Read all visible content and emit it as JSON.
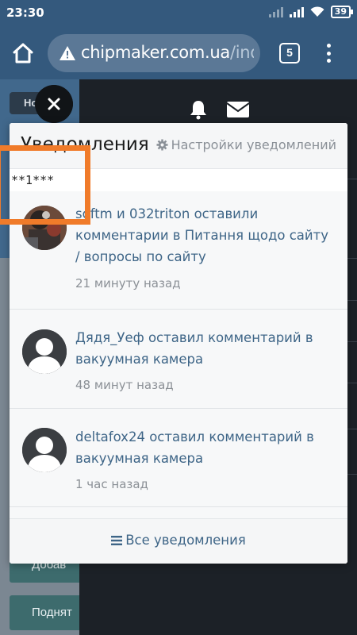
{
  "status_bar": {
    "time": "23:30",
    "battery": "39"
  },
  "browser": {
    "url_host": "chipmaker.com.ua",
    "url_path": "/index",
    "tab_count": "5"
  },
  "background": {
    "breadcrumb": "Но",
    "buttons": [
      "Добав",
      "Поднят"
    ]
  },
  "notifications": {
    "title": "Уведомления",
    "settings_label": "Настройки уведомлений",
    "marker_text": "**1***",
    "items": [
      {
        "text": "softm и 032triton оставили комментарии в Питання щодо сайту / вопросы по сайту",
        "time": "21 минуту назад",
        "avatar": "photo"
      },
      {
        "text": "Дядя_Уеф оставил комментарий в вакуумная камера",
        "time": "48 минут назад",
        "avatar": "default"
      },
      {
        "text": "deltafox24 оставил комментарий в вакуумная камера",
        "time": "1 час назад",
        "avatar": "default"
      }
    ],
    "all_label": "Все уведомления"
  },
  "colors": {
    "toolbar": "#34597d",
    "link": "#3e6587",
    "highlight": "#f07b2a"
  }
}
